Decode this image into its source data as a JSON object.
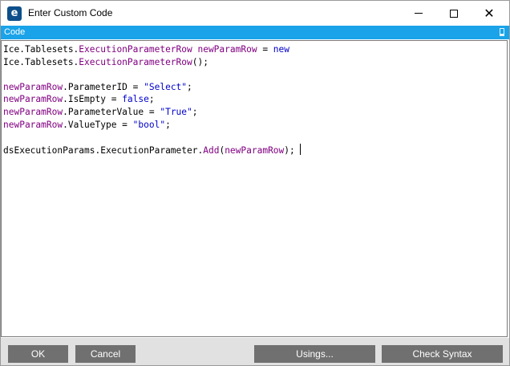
{
  "window": {
    "title": "Enter Custom Code",
    "app_icon_letter": "e"
  },
  "code_panel": {
    "header": "Code"
  },
  "code_lines": [
    [
      {
        "t": "Ice.Tablesets.",
        "c": ""
      },
      {
        "t": "ExecutionParameterRow newParamRow",
        "c": "k"
      },
      {
        "t": " = ",
        "c": ""
      },
      {
        "t": "new",
        "c": "b"
      }
    ],
    [
      {
        "t": "Ice.Tablesets.",
        "c": ""
      },
      {
        "t": "ExecutionParameterRow",
        "c": "k"
      },
      {
        "t": "();",
        "c": ""
      }
    ],
    [],
    [
      {
        "t": "newParamRow",
        "c": "k"
      },
      {
        "t": ".ParameterID = ",
        "c": ""
      },
      {
        "t": "\"Select\"",
        "c": "b"
      },
      {
        "t": ";",
        "c": ""
      }
    ],
    [
      {
        "t": "newParamRow",
        "c": "k"
      },
      {
        "t": ".IsEmpty = ",
        "c": ""
      },
      {
        "t": "false",
        "c": "b"
      },
      {
        "t": ";",
        "c": ""
      }
    ],
    [
      {
        "t": "newParamRow",
        "c": "k"
      },
      {
        "t": ".ParameterValue = ",
        "c": ""
      },
      {
        "t": "\"True\"",
        "c": "b"
      },
      {
        "t": ";",
        "c": ""
      }
    ],
    [
      {
        "t": "newParamRow",
        "c": "k"
      },
      {
        "t": ".ValueType = ",
        "c": ""
      },
      {
        "t": "\"bool\"",
        "c": "b"
      },
      {
        "t": ";",
        "c": ""
      }
    ],
    [],
    [
      {
        "t": "dsExecutionParams.ExecutionParameter.",
        "c": ""
      },
      {
        "t": "Add",
        "c": "k"
      },
      {
        "t": "(",
        "c": ""
      },
      {
        "t": "newParamRow",
        "c": "k"
      },
      {
        "t": ");",
        "c": ""
      }
    ]
  ],
  "buttons": {
    "ok": "OK",
    "cancel": "Cancel",
    "usings": "Usings...",
    "check_syntax": "Check Syntax"
  },
  "colors": {
    "header_bg": "#1aa3e8",
    "button_bg": "#707070",
    "identifier": "#800080",
    "literal": "#0000cc"
  }
}
